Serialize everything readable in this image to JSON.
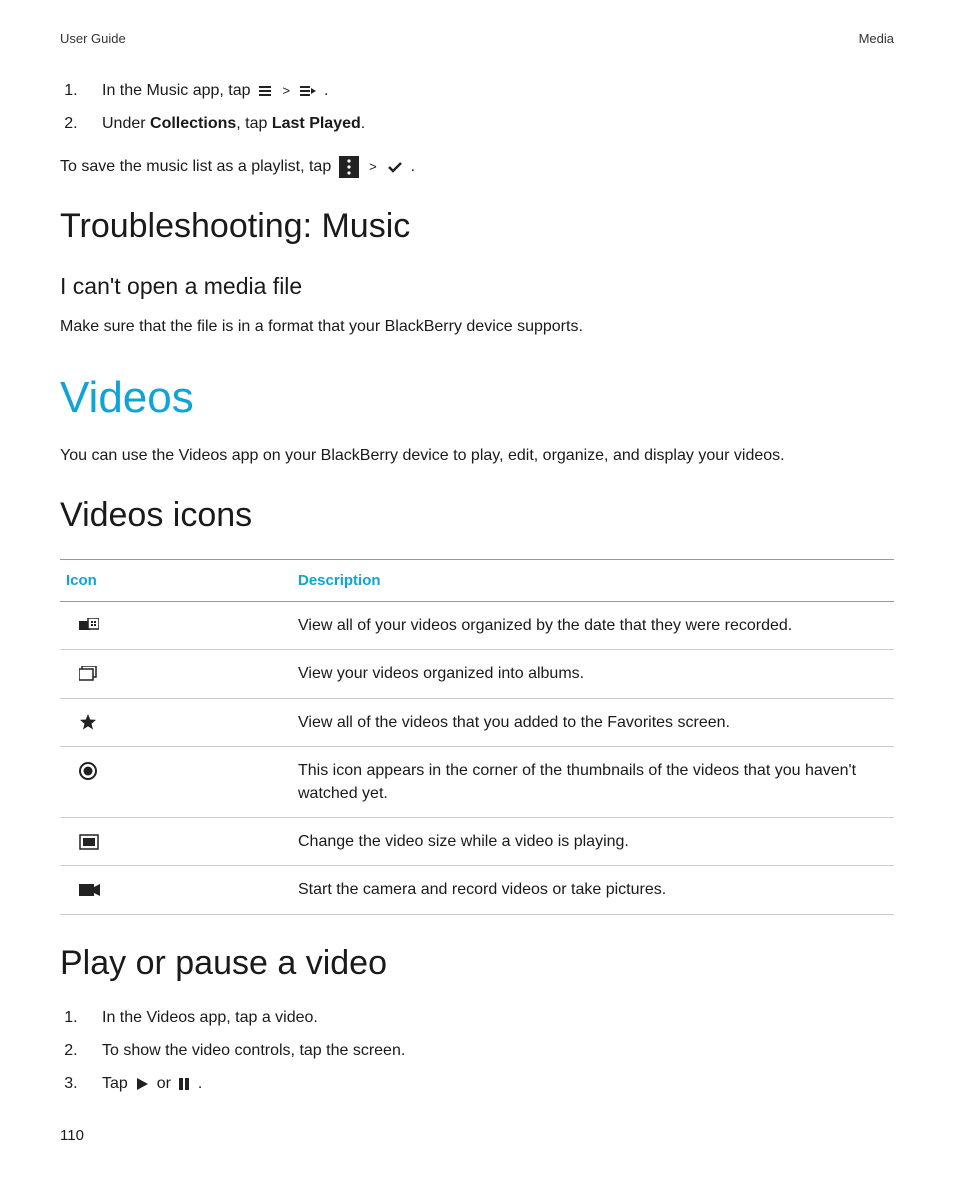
{
  "header": {
    "left": "User Guide",
    "right": "Media"
  },
  "steps_top": {
    "s1_a": "In the Music app, tap ",
    "s1_b": " .",
    "s2_a": "Under ",
    "s2_b": "Collections",
    "s2_c": ", tap ",
    "s2_d": "Last Played",
    "s2_e": "."
  },
  "save_line": {
    "a": "To save the music list as a playlist, tap ",
    "b": " ."
  },
  "troubleshoot_heading": "Troubleshooting: Music",
  "cant_open_heading": "I can't open a media file",
  "cant_open_body": "Make sure that the file is in a format that your BlackBerry device supports.",
  "videos_heading": "Videos",
  "videos_intro": "You can use the Videos app on your BlackBerry device to play, edit, organize, and display your videos.",
  "videos_icons_heading": "Videos icons",
  "table": {
    "col_icon": "Icon",
    "col_desc": "Description",
    "rows": [
      {
        "icon": "date",
        "desc": "View all of your videos organized by the date that they were recorded."
      },
      {
        "icon": "albums",
        "desc": "View your videos organized into albums."
      },
      {
        "icon": "star",
        "desc": "View all of the videos that you added to the Favorites screen."
      },
      {
        "icon": "unwatched",
        "desc": "This icon appears in the corner of the thumbnails of the videos that you haven't watched yet."
      },
      {
        "icon": "resize",
        "desc": "Change the video size while a video is playing."
      },
      {
        "icon": "camera",
        "desc": "Start the camera and record videos or take pictures."
      }
    ]
  },
  "play_heading": "Play or pause a video",
  "play_steps": {
    "s1": "In the Videos app, tap a video.",
    "s2": "To show the video controls, tap the screen.",
    "s3_a": "Tap ",
    "s3_b": " or ",
    "s3_c": " ."
  },
  "page_number": "110",
  "sep": ">"
}
